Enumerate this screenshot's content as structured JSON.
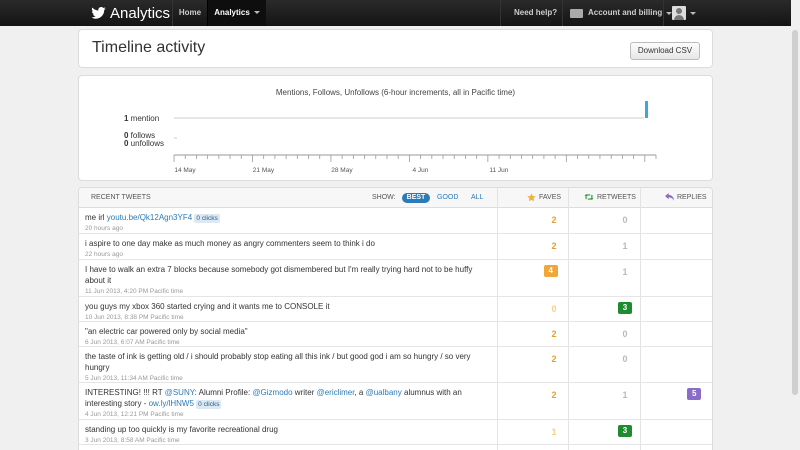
{
  "nav": {
    "brand": "Analytics",
    "home": "Home",
    "analytics": "Analytics",
    "help": "Need help?",
    "account": "Account and billing"
  },
  "page": {
    "title": "Timeline activity",
    "download_button": "Download CSV"
  },
  "chart_data": {
    "type": "line",
    "title": "Mentions, Follows, Unfollows (6-hour increments, all in Pacific time)",
    "x_tick_labels": [
      "14 May",
      "21 May",
      "28 May",
      "4 Jun",
      "11 Jun"
    ],
    "series": [
      {
        "label_count": "1",
        "label_text": "mention",
        "color": "#3aa9d9"
      },
      {
        "label_count": "0",
        "label_text": "follows",
        "color": "#999999"
      },
      {
        "label_count": "0",
        "label_text": "unfollows",
        "color": "#999999"
      }
    ],
    "mentions_spike_date": "12 Jun",
    "grid": false
  },
  "table": {
    "header": {
      "recent": "RECENT TWEETS",
      "show": "SHOW:",
      "best": "BEST",
      "good": "GOOD",
      "all": "ALL",
      "faves": "FAVES",
      "retweets": "RETWEETS",
      "replies": "REPLIES"
    },
    "colors": {
      "fave": "#e8a035",
      "retweet": "#1f8b2f",
      "reply": "#8a6bc8",
      "link": "#2b7bb9"
    },
    "rows": [
      {
        "pre": "me irl ",
        "link": "youtu.be/Qk12Agn3YF4",
        "clicks": "0 clicks",
        "post": "",
        "time": "20 hours ago",
        "faves": "2",
        "retweets": "0",
        "replies": "1"
      },
      {
        "pre": "i aspire to one day make as much money as angry commenters seem to think i do",
        "time": "22 hours ago",
        "faves": "2",
        "retweets": "1",
        "replies": "1"
      },
      {
        "pre": "I have to walk an extra 7 blocks because somebody got dismembered but I'm really trying hard not to be huffy about it",
        "time": "11 Jun 2013, 4:20 PM Pacific time",
        "faves": "4",
        "retweets": "1",
        "replies": "2"
      },
      {
        "pre": "you guys my xbox 360 started crying and it wants me to CONSOLE it",
        "time": "10 Jun 2013, 8:38 PM Pacific time",
        "faves": "0",
        "retweets": "3",
        "replies": "1"
      },
      {
        "pre": "\"an electric car powered only by social media\"",
        "time": "6 Jun 2013, 6:07 AM Pacific time",
        "faves": "2",
        "retweets": "0",
        "replies": "1"
      },
      {
        "pre": "the taste of ink is getting old / i should probably stop eating all this ink / but good god i am so hungry / so very hungry",
        "time": "5 Jun 2013, 11:34 AM Pacific time",
        "faves": "2",
        "retweets": "0",
        "replies": "0"
      },
      {
        "p1": "INTERESTING! !!! RT ",
        "m1": "@SUNY",
        "p2": ": Alumni Profile: ",
        "m2": "@Gizmodo",
        "p3": " writer ",
        "m3": "@ericlimer",
        "p4": ", a ",
        "m4": "@ualbany",
        "p5": " alumnus with an interesting story - ",
        "link": "ow.ly/lHNW5",
        "clicks": "0 clicks",
        "time": "4 Jun 2013, 12:21 PM Pacific time",
        "faves": "2",
        "retweets": "1",
        "replies": "5"
      },
      {
        "pre": "standing up too quickly is my favorite recreational drug",
        "time": "3 Jun 2013, 8:58 AM Pacific time",
        "faves": "1",
        "retweets": "3",
        "replies": "0"
      }
    ]
  }
}
